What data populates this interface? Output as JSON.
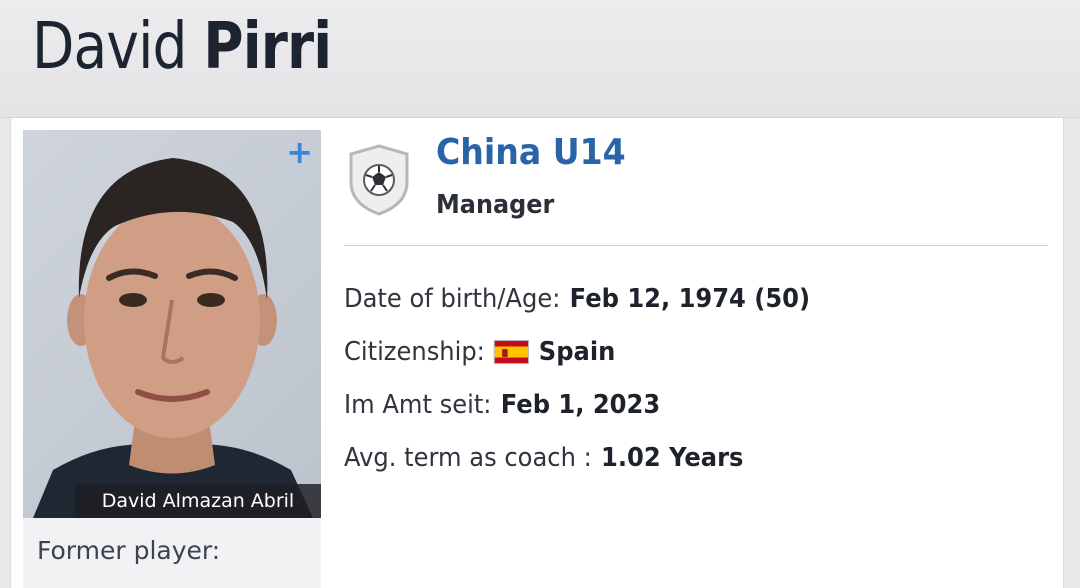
{
  "header": {
    "first_name": "David",
    "last_name": "Pirri"
  },
  "photo": {
    "caption": "David Almazan Abril",
    "plus_label": "+"
  },
  "former": {
    "label": "Former player:"
  },
  "club": {
    "name": "China U14",
    "role": "Manager",
    "crest_icon": "football-crest-icon"
  },
  "info": {
    "dob_label": "Date of birth/Age:",
    "dob_value": "Feb 12, 1974 (50)",
    "citizenship_label": "Citizenship:",
    "citizenship_value": "Spain",
    "citizenship_flag": "spain-flag-icon",
    "appointed_label": "Im Amt seit:",
    "appointed_value": "Feb 1, 2023",
    "term_label": "Avg. term as coach :",
    "term_value": "1.02 Years"
  },
  "colors": {
    "accent_blue": "#2a64a8",
    "plus_blue": "#3c86d6",
    "text_dark": "#1d2431",
    "flag_red": "#c60b1e",
    "flag_yellow": "#ffc400"
  }
}
